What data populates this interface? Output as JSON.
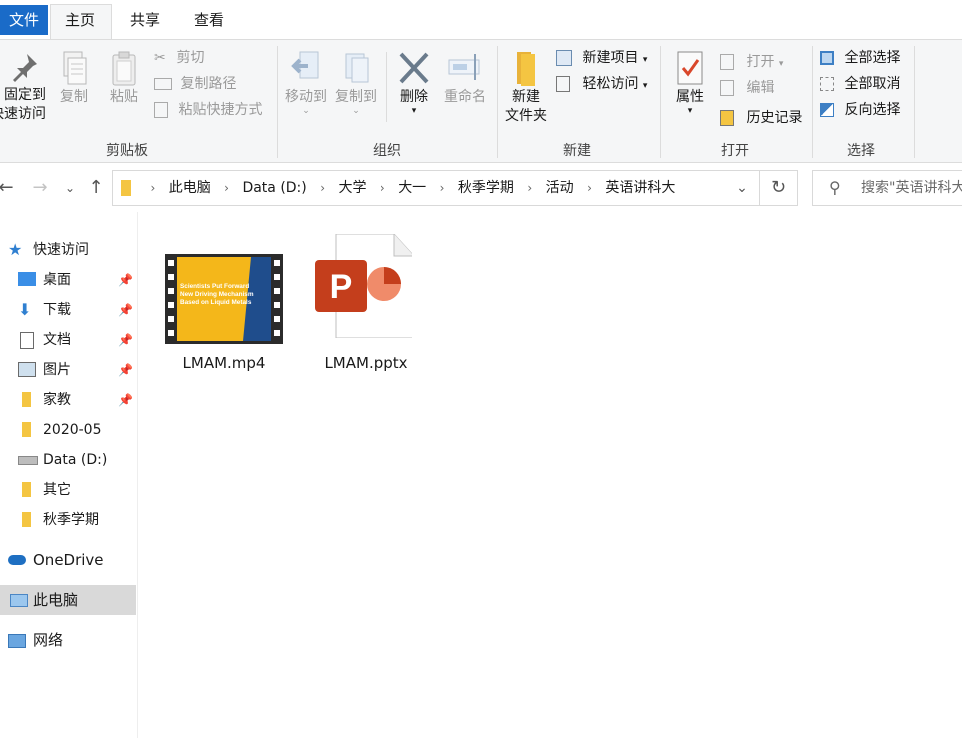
{
  "tabs": {
    "file": "文件",
    "home": "主页",
    "share": "共享",
    "view": "查看"
  },
  "ribbon": {
    "clipboard": {
      "pin_line1": "固定到",
      "pin_line2": "快速访问",
      "copy": "复制",
      "paste": "粘贴",
      "cut": "剪切",
      "copy_path": "复制路径",
      "paste_shortcut": "粘贴快捷方式",
      "label": "剪贴板"
    },
    "organize": {
      "move_to": "移动到",
      "copy_to": "复制到",
      "delete": "删除",
      "rename": "重命名",
      "label": "组织"
    },
    "new": {
      "new_folder_line1": "新建",
      "new_folder_line2": "文件夹",
      "new_item": "新建项目",
      "easy_access": "轻松访问",
      "label": "新建"
    },
    "open": {
      "properties": "属性",
      "open": "打开",
      "edit": "编辑",
      "history": "历史记录",
      "label": "打开"
    },
    "select": {
      "select_all": "全部选择",
      "select_none": "全部取消",
      "invert": "反向选择",
      "label": "选择"
    }
  },
  "address": {
    "crumbs": [
      "此电脑",
      "Data (D:)",
      "大学",
      "大一",
      "秋季学期",
      "活动",
      "英语讲科大"
    ]
  },
  "search": {
    "placeholder": "搜索\"英语讲科大\""
  },
  "nav": {
    "quick_access": "快速访问",
    "items": [
      "桌面",
      "下载",
      "文档",
      "图片",
      "家教",
      "2020-05",
      "Data (D:)",
      "其它",
      "秋季学期"
    ],
    "onedrive": "OneDrive",
    "this_pc": "此电脑",
    "network": "网络"
  },
  "files": [
    {
      "name": "LMAM.mp4",
      "thumb_text": [
        "Scientists Put Forward",
        "New Driving Mechanism",
        "Based on Liquid Metals"
      ]
    },
    {
      "name": "LMAM.pptx",
      "icon_letter": "P"
    }
  ],
  "colors": {
    "accent": "#1a6bc8",
    "folder": "#f4c542",
    "ppt": "#c43e1c"
  }
}
